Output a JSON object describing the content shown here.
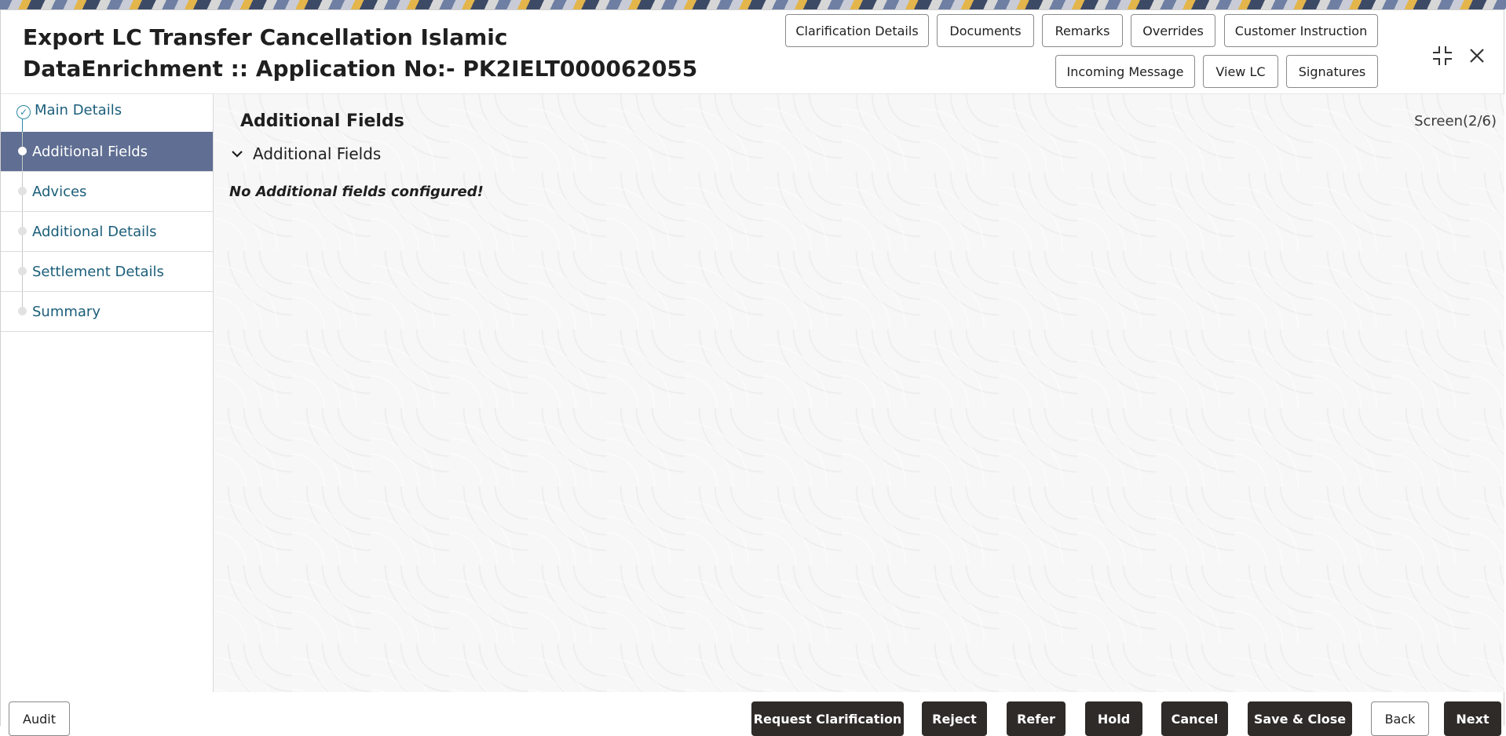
{
  "header": {
    "title": "Export LC Transfer Cancellation Islamic DataEnrichment :: Application No:- PK2IELT000062055",
    "buttons_row1": [
      "Clarification Details",
      "Documents",
      "Remarks",
      "Overrides",
      "Customer Instruction"
    ],
    "buttons_row2": [
      "Incoming Message",
      "View LC",
      "Signatures"
    ]
  },
  "sidebar": {
    "items": [
      {
        "label": "Main Details",
        "state": "completed"
      },
      {
        "label": "Additional Fields",
        "state": "active"
      },
      {
        "label": "Advices",
        "state": "pending"
      },
      {
        "label": "Additional Details",
        "state": "pending"
      },
      {
        "label": "Settlement Details",
        "state": "pending"
      },
      {
        "label": "Summary",
        "state": "pending"
      }
    ]
  },
  "main": {
    "section_title": "Additional Fields",
    "screen_indicator": "Screen(2/6)",
    "panel_title": "Additional Fields",
    "empty_message": "No Additional fields configured!"
  },
  "footer": {
    "audit": "Audit",
    "actions": [
      "Request Clarification",
      "Reject",
      "Refer",
      "Hold",
      "Cancel",
      "Save & Close",
      "Back",
      "Next"
    ]
  },
  "colors": {
    "active_step_bg": "#5f6e92",
    "link_text": "#1b5e7a",
    "dark_button": "#2f2b28"
  }
}
